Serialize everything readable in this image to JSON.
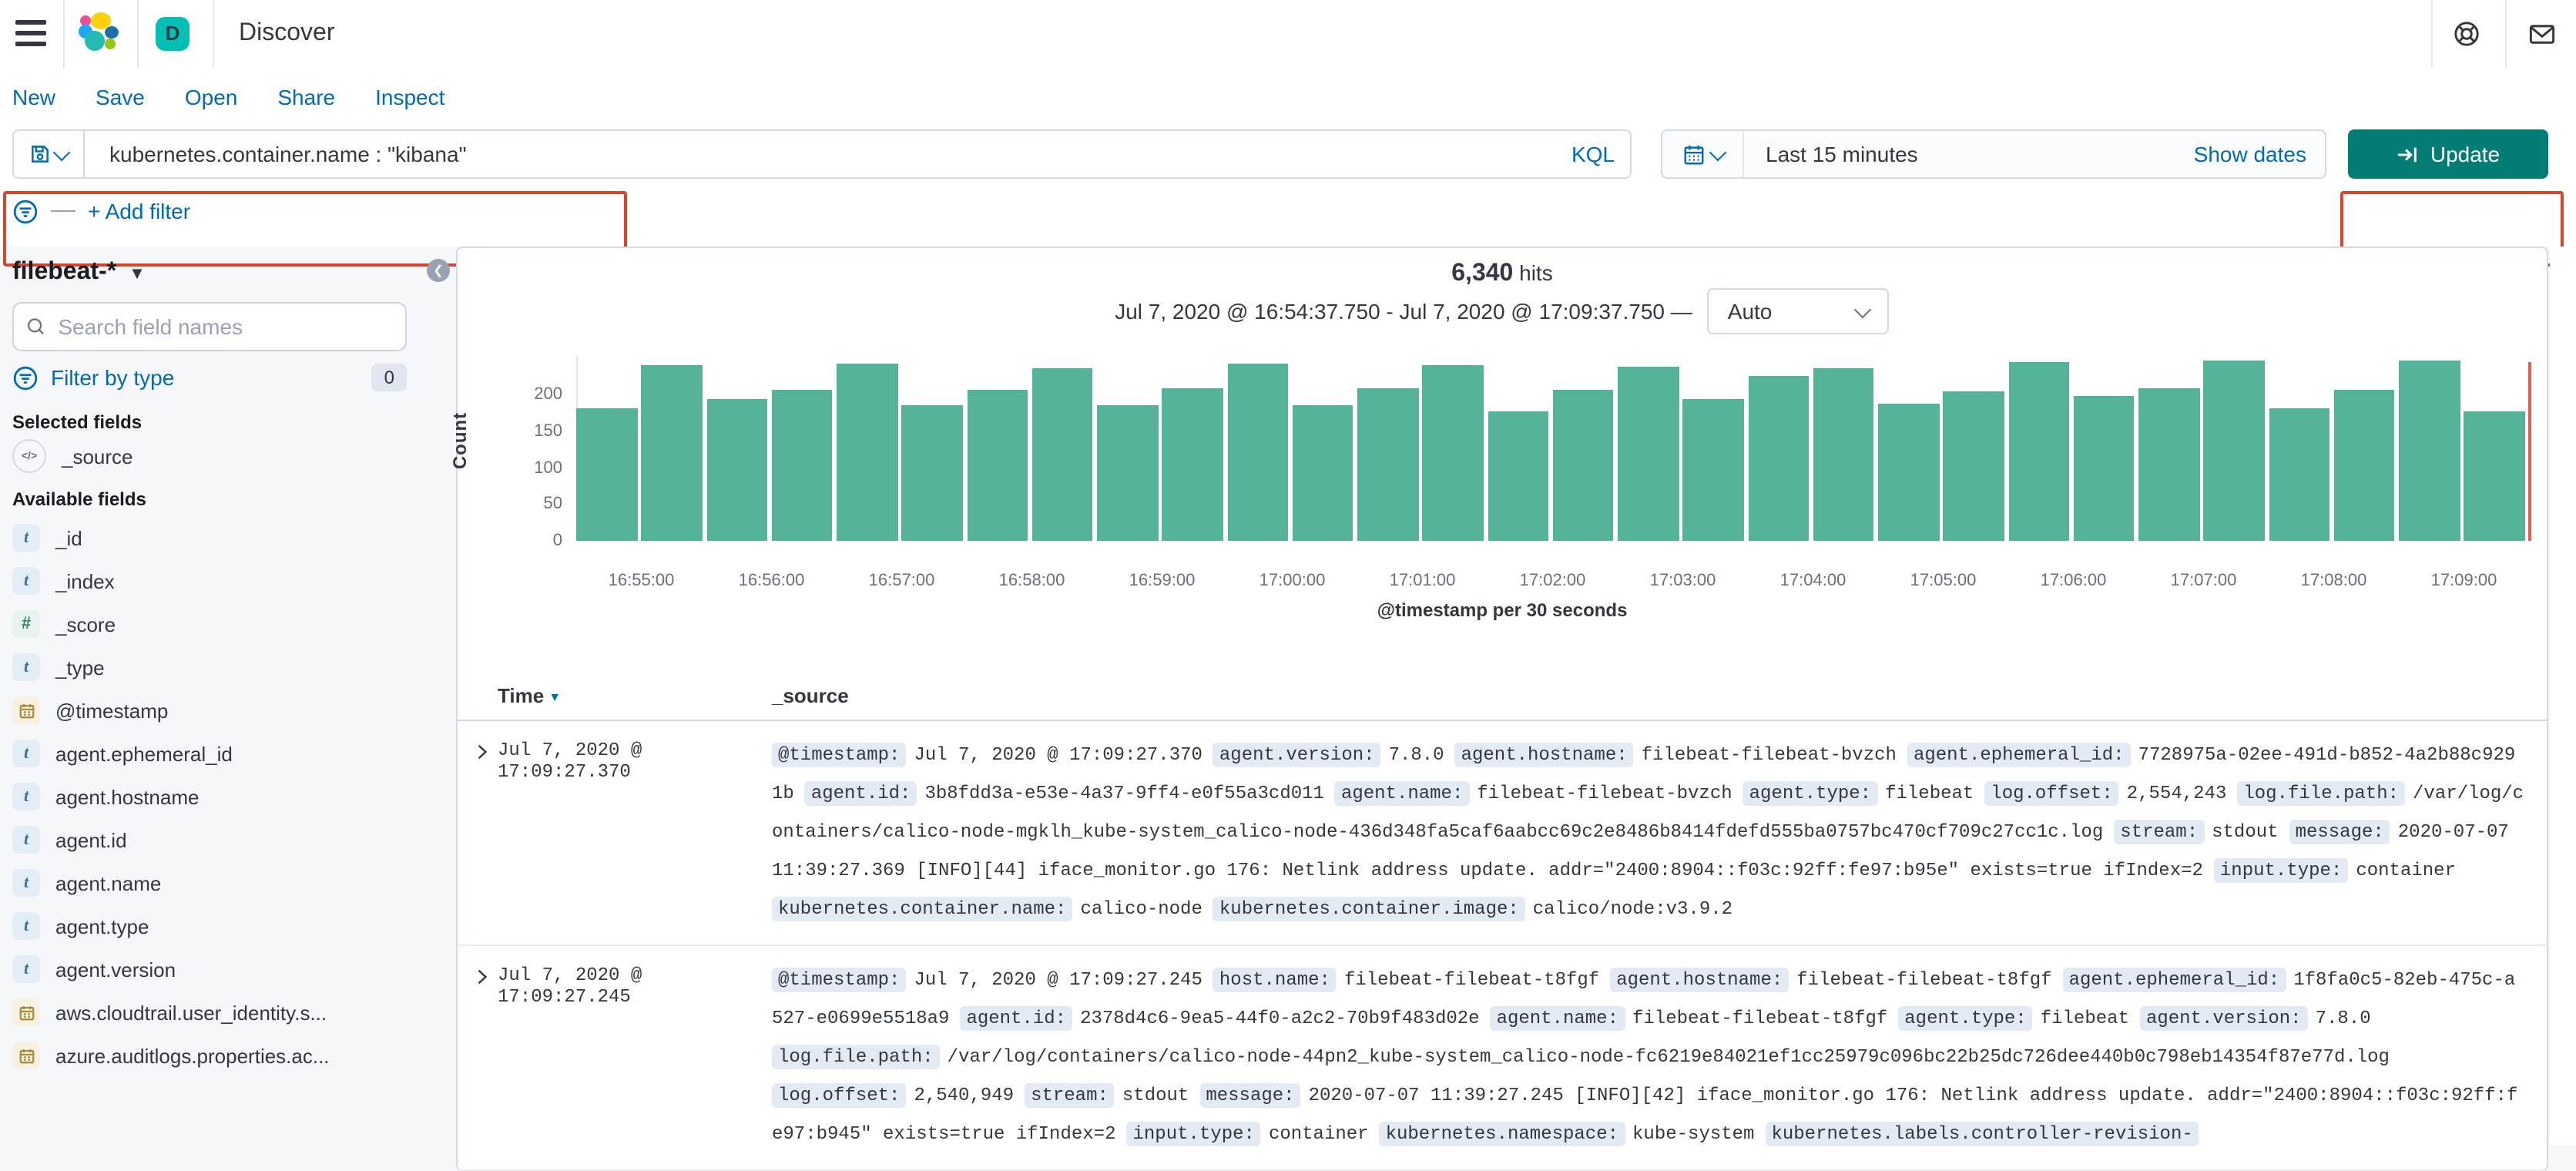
{
  "header": {
    "app_initial": "D",
    "title": "Discover"
  },
  "toolbar": {
    "links": [
      "New",
      "Save",
      "Open",
      "Share",
      "Inspect"
    ]
  },
  "query_bar": {
    "query": "kubernetes.container.name : \"kibana\"",
    "language": "KQL"
  },
  "time_picker": {
    "range": "Last 15 minutes",
    "show_dates": "Show dates",
    "update": "Update"
  },
  "filter_bar": {
    "add_filter": "+ Add filter"
  },
  "sidebar": {
    "index_pattern": "filebeat-*",
    "search_placeholder": "Search field names",
    "filter_by_type": "Filter by type",
    "filter_count": "0",
    "selected_header": "Selected fields",
    "selected": [
      {
        "name": "_source",
        "type": "source"
      }
    ],
    "available_header": "Available fields",
    "available": [
      {
        "name": "_id",
        "type": "string"
      },
      {
        "name": "_index",
        "type": "string"
      },
      {
        "name": "_score",
        "type": "number"
      },
      {
        "name": "_type",
        "type": "string"
      },
      {
        "name": "@timestamp",
        "type": "date"
      },
      {
        "name": "agent.ephemeral_id",
        "type": "string"
      },
      {
        "name": "agent.hostname",
        "type": "string"
      },
      {
        "name": "agent.id",
        "type": "string"
      },
      {
        "name": "agent.name",
        "type": "string"
      },
      {
        "name": "agent.type",
        "type": "string"
      },
      {
        "name": "agent.version",
        "type": "string"
      },
      {
        "name": "aws.cloudtrail.user_identity.s...",
        "type": "date"
      },
      {
        "name": "azure.auditlogs.properties.ac...",
        "type": "date"
      }
    ]
  },
  "chart_data": {
    "type": "bar",
    "hits": "6,340",
    "hits_label": "hits",
    "range_label": "Jul 7, 2020 @ 16:54:37.750 - Jul 7, 2020 @ 17:09:37.750 —",
    "interval_label": "Auto",
    "xlabel": "@timestamp per 30 seconds",
    "ylabel": "Count",
    "ylim": [
      0,
      250
    ],
    "yticks": [
      0,
      50,
      100,
      150,
      200
    ],
    "xticks": [
      "16:55:00",
      "16:56:00",
      "16:57:00",
      "16:58:00",
      "16:59:00",
      "17:00:00",
      "17:01:00",
      "17:02:00",
      "17:03:00",
      "17:04:00",
      "17:05:00",
      "17:06:00",
      "17:07:00",
      "17:08:00",
      "17:09:00"
    ],
    "values": [
      181,
      240,
      193,
      207,
      243,
      186,
      207,
      235,
      185,
      209,
      243,
      185,
      209,
      240,
      178,
      207,
      238,
      193,
      225,
      236,
      187,
      205,
      244,
      197,
      208,
      247,
      182,
      206,
      246,
      178
    ],
    "bar_color": "#54B399",
    "now_line_color": "#E0614D",
    "legend": "off",
    "grid": "off"
  },
  "table": {
    "columns": [
      "Time",
      "_source"
    ],
    "rows": [
      {
        "time": "Jul 7, 2020 @ 17:09:27.370",
        "fields": [
          [
            "@timestamp:",
            "Jul 7, 2020 @ 17:09:27.370"
          ],
          [
            "agent.version:",
            "7.8.0"
          ],
          [
            "agent.hostname:",
            "filebeat-filebeat-bvzch"
          ],
          [
            "agent.ephemeral_id:",
            "7728975a-02ee-491d-b852-4a2b88c9291b"
          ],
          [
            "agent.id:",
            "3b8fdd3a-e53e-4a37-9ff4-e0f55a3cd011"
          ],
          [
            "agent.name:",
            "filebeat-filebeat-bvzch"
          ],
          [
            "agent.type:",
            "filebeat"
          ],
          [
            "log.offset:",
            "2,554,243"
          ],
          [
            "log.file.path:",
            "/var/log/containers/calico-node-mgklh_kube-system_calico-node-436d348fa5caf6aabcc69c2e8486b8414fdefd555ba0757bc470cf709c27cc1c.log"
          ],
          [
            "stream:",
            "stdout"
          ],
          [
            "message:",
            "2020-07-07 11:39:27.369 [INFO][44] iface_monitor.go 176: Netlink address update. addr=\"2400:8904::f03c:92ff:fe97:b95e\" exists=true ifIndex=2"
          ],
          [
            "input.type:",
            "container"
          ],
          [
            "kubernetes.container.name:",
            "calico-node"
          ],
          [
            "kubernetes.container.image:",
            "calico/node:v3.9.2"
          ]
        ]
      },
      {
        "time": "Jul 7, 2020 @ 17:09:27.245",
        "fields": [
          [
            "@timestamp:",
            "Jul 7, 2020 @ 17:09:27.245"
          ],
          [
            "host.name:",
            "filebeat-filebeat-t8fgf"
          ],
          [
            "agent.hostname:",
            "filebeat-filebeat-t8fgf"
          ],
          [
            "agent.ephemeral_id:",
            "1f8fa0c5-82eb-475c-a527-e0699e5518a9"
          ],
          [
            "agent.id:",
            "2378d4c6-9ea5-44f0-a2c2-70b9f483d02e"
          ],
          [
            "agent.name:",
            "filebeat-filebeat-t8fgf"
          ],
          [
            "agent.type:",
            "filebeat"
          ],
          [
            "agent.version:",
            "7.8.0"
          ],
          [
            "log.file.path:",
            "/var/log/containers/calico-node-44pn2_kube-system_calico-node-fc6219e84021ef1cc25979c096bc22b25dc726dee440b0c798eb14354f87e77d.log"
          ],
          [
            "log.offset:",
            "2,540,949"
          ],
          [
            "stream:",
            "stdout"
          ],
          [
            "message:",
            "2020-07-07 11:39:27.245 [INFO][42] iface_monitor.go 176: Netlink address update. addr=\"2400:8904::f03c:92ff:fe97:b945\" exists=true ifIndex=2"
          ],
          [
            "input.type:",
            "container"
          ],
          [
            "kubernetes.namespace:",
            "kube-system"
          ],
          [
            "kubernetes.labels.controller-revision-",
            ""
          ]
        ]
      }
    ]
  }
}
